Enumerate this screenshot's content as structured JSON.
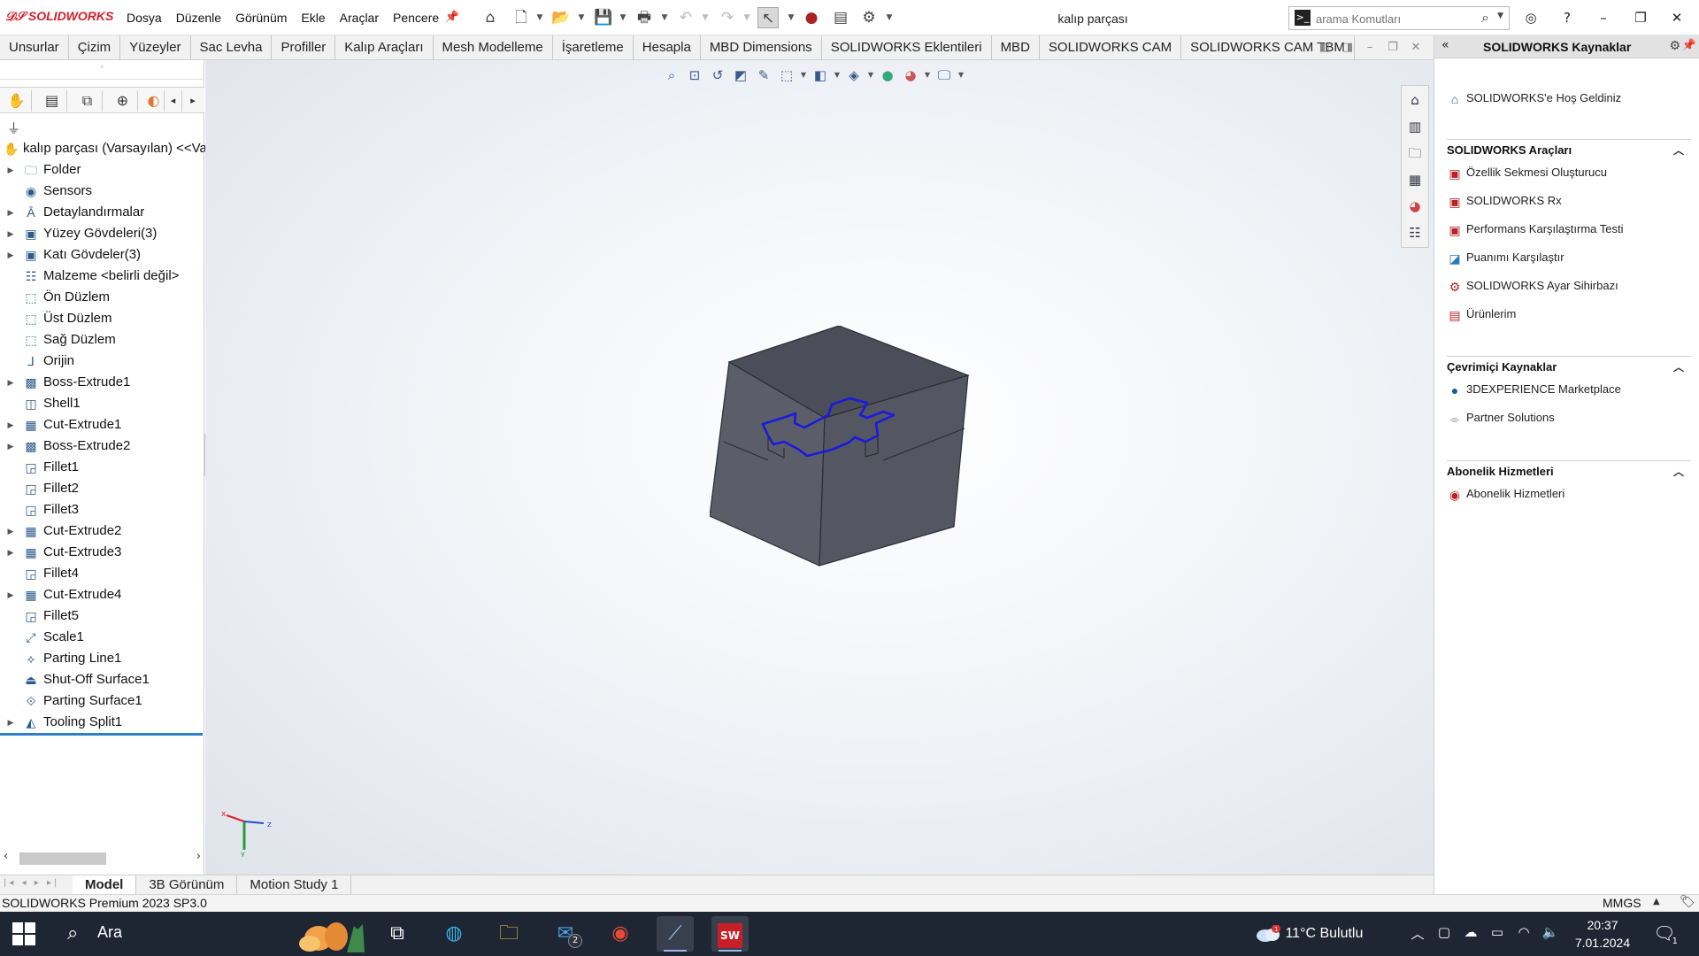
{
  "app": {
    "logo_text": "SOLIDWORKS",
    "document_title": "kalıp parçası",
    "menus": [
      "Dosya",
      "Düzenle",
      "Görünüm",
      "Ekle",
      "Araçlar",
      "Pencere"
    ]
  },
  "search": {
    "placeholder": "arama Komutları"
  },
  "command_tabs": [
    "Unsurlar",
    "Çizim",
    "Yüzeyler",
    "Sac Levha",
    "Profiller",
    "Kalıp Araçları",
    "Mesh Modelleme",
    "İşaretleme",
    "Hesapla",
    "MBD Dimensions",
    "SOLIDWORKS Eklentileri",
    "MBD",
    "SOLIDWORKS CAM",
    "SOLIDWORKS CAM TBM"
  ],
  "feature_tree": {
    "root": "kalıp parçası  (Varsayılan) <<Va",
    "items": [
      {
        "label": "Folder",
        "icon": "folder-icon",
        "expandable": true
      },
      {
        "label": "Sensors",
        "icon": "sensor-icon",
        "expandable": false
      },
      {
        "label": "Detaylandırmalar",
        "icon": "annotation-icon",
        "expandable": true
      },
      {
        "label": "Yüzey Gövdeleri(3)",
        "icon": "surface-bodies-icon",
        "expandable": true
      },
      {
        "label": "Katı Gövdeler(3)",
        "icon": "solid-bodies-icon",
        "expandable": true
      },
      {
        "label": "Malzeme <belirli değil>",
        "icon": "material-icon",
        "expandable": false
      },
      {
        "label": "Ön Düzlem",
        "icon": "plane-icon",
        "expandable": false
      },
      {
        "label": "Üst Düzlem",
        "icon": "plane-icon",
        "expandable": false
      },
      {
        "label": "Sağ Düzlem",
        "icon": "plane-icon",
        "expandable": false
      },
      {
        "label": "Orijin",
        "icon": "origin-icon",
        "expandable": false
      },
      {
        "label": "Boss-Extrude1",
        "icon": "extrude-icon",
        "expandable": true
      },
      {
        "label": "Shell1",
        "icon": "shell-icon",
        "expandable": false
      },
      {
        "label": "Cut-Extrude1",
        "icon": "cut-extrude-icon",
        "expandable": true
      },
      {
        "label": "Boss-Extrude2",
        "icon": "extrude-icon",
        "expandable": true
      },
      {
        "label": "Fillet1",
        "icon": "fillet-icon",
        "expandable": false
      },
      {
        "label": "Fillet2",
        "icon": "fillet-icon",
        "expandable": false
      },
      {
        "label": "Fillet3",
        "icon": "fillet-icon",
        "expandable": false
      },
      {
        "label": "Cut-Extrude2",
        "icon": "cut-extrude-icon",
        "expandable": true
      },
      {
        "label": "Cut-Extrude3",
        "icon": "cut-extrude-icon",
        "expandable": true
      },
      {
        "label": "Fillet4",
        "icon": "fillet-icon",
        "expandable": false
      },
      {
        "label": "Cut-Extrude4",
        "icon": "cut-extrude-icon",
        "expandable": true
      },
      {
        "label": "Fillet5",
        "icon": "fillet-icon",
        "expandable": false
      },
      {
        "label": "Scale1",
        "icon": "scale-icon",
        "expandable": false
      },
      {
        "label": "Parting Line1",
        "icon": "parting-line-icon",
        "expandable": false
      },
      {
        "label": "Shut-Off Surface1",
        "icon": "shut-off-surface-icon",
        "expandable": false
      },
      {
        "label": "Parting Surface1",
        "icon": "parting-surface-icon",
        "expandable": false
      },
      {
        "label": "Tooling Split1",
        "icon": "tooling-split-icon",
        "expandable": true
      }
    ]
  },
  "resources": {
    "title": "SOLIDWORKS Kaynaklar",
    "welcome": "SOLIDWORKS'e Hoş Geldiniz",
    "sections": [
      {
        "title": "SOLIDWORKS Araçları",
        "items": [
          "Özellik Sekmesi Oluşturucu",
          "SOLIDWORKS Rx",
          "Performans Karşılaştırma Testi",
          "Puanımı Karşılaştır",
          "SOLIDWORKS Ayar Sihirbazı",
          "Ürünlerim"
        ]
      },
      {
        "title": "Çevrimiçi Kaynaklar",
        "items": [
          "3DEXPERIENCE Marketplace",
          "Partner Solutions"
        ]
      },
      {
        "title": "Abonelik Hizmetleri",
        "items": [
          "Abonelik Hizmetleri"
        ]
      }
    ]
  },
  "bottom_tabs": [
    "Model",
    "3B Görünüm",
    "Motion Study 1"
  ],
  "status": {
    "left": "SOLIDWORKS Premium 2023 SP3.0",
    "units": "MMGS"
  },
  "taskbar": {
    "search_label": "Ara",
    "mail_badge": "2",
    "weather": "11°C  Bulutlu",
    "weather_badge": "1",
    "time": "20:37",
    "date": "7.01.2024",
    "notification_count": "1"
  },
  "colors": {
    "accent_red": "#d4202a",
    "parting_line": "#1a1adf",
    "part_gray": "#5b5e69",
    "taskbar": "#1d2632"
  }
}
